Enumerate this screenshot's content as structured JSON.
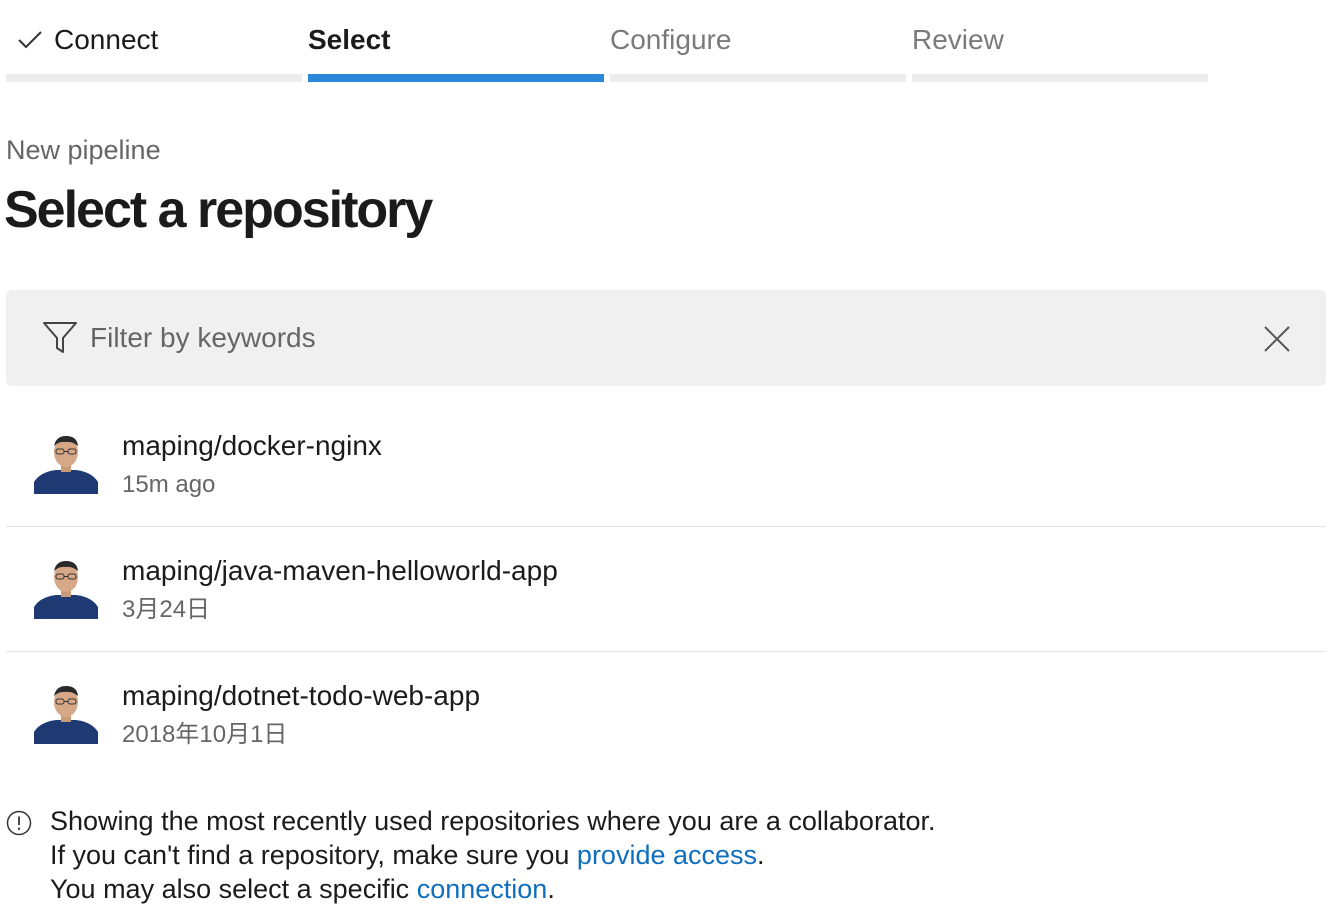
{
  "wizard": {
    "steps": [
      {
        "label": "Connect",
        "state": "done"
      },
      {
        "label": "Select",
        "state": "active"
      },
      {
        "label": "Configure",
        "state": "pending"
      },
      {
        "label": "Review",
        "state": "pending"
      }
    ],
    "active_color": "#2b88d8",
    "inactive_color": "#ededed"
  },
  "header": {
    "breadcrumb": "New pipeline",
    "title": "Select a repository"
  },
  "filter": {
    "placeholder": "Filter by keywords",
    "value": "",
    "icon": "filter-icon",
    "clear_icon": "close-icon"
  },
  "repositories": [
    {
      "name": "maping/docker-nginx",
      "updated": "15m ago",
      "avatar": "user-avatar"
    },
    {
      "name": "maping/java-maven-helloworld-app",
      "updated": "3月24日",
      "avatar": "user-avatar"
    },
    {
      "name": "maping/dotnet-todo-web-app",
      "updated": "2018年10月1日",
      "avatar": "user-avatar"
    }
  ],
  "info": {
    "icon": "info-icon",
    "line1": "Showing the most recently used repositories where you are a collaborator.",
    "line2_prefix": "If you can't find a repository, make sure you ",
    "line2_link": "provide access",
    "line2_suffix": ".",
    "line3_prefix": "You may also select a specific ",
    "line3_link": "connection",
    "line3_suffix": "."
  }
}
